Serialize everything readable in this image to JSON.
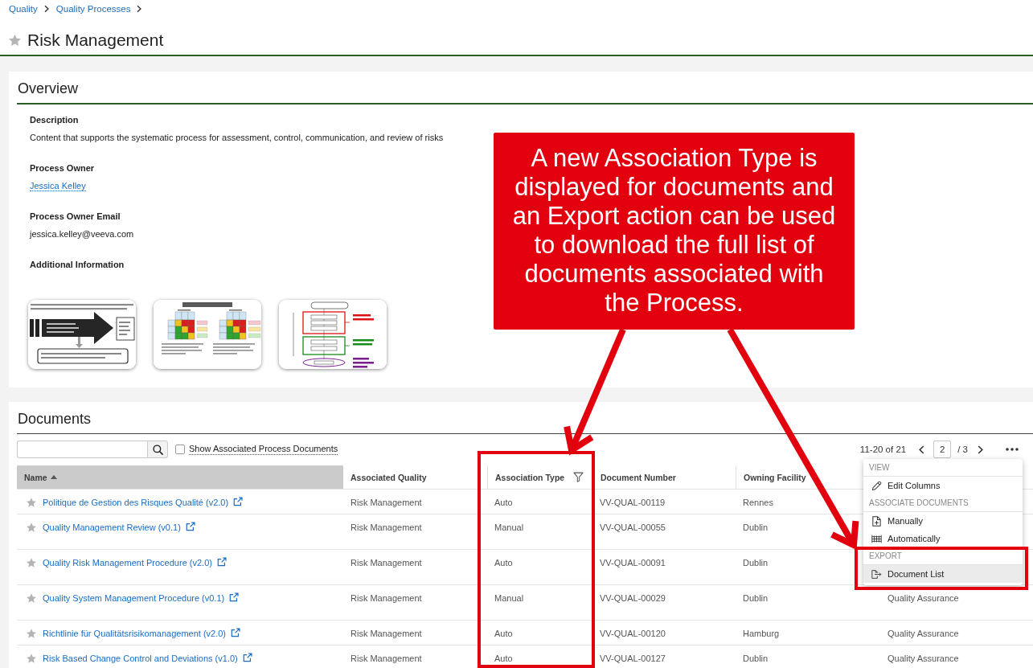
{
  "breadcrumb": [
    {
      "label": "Quality"
    },
    {
      "label": "Quality Processes"
    }
  ],
  "page": {
    "title": "Risk Management",
    "favorite": false
  },
  "overview": {
    "title": "Overview",
    "fields": [
      {
        "kind": "text",
        "label": "Description",
        "value": "Content that supports the systematic process for assessment, control, communication, and review of risks"
      },
      {
        "kind": "link",
        "label": "Process Owner",
        "value": "Jessica Kelley"
      },
      {
        "kind": "text",
        "label": "Process Owner Email",
        "value": "jessica.kelley@veeva.com"
      },
      {
        "kind": "images",
        "label": "Additional Information",
        "images": [
          {
            "kind": "arrow-diagram"
          },
          {
            "kind": "risk-matrix"
          },
          {
            "kind": "flowchart"
          }
        ]
      }
    ]
  },
  "documents": {
    "title": "Documents",
    "show_associated": {
      "label": "Show Associated Process Documents",
      "checked": false
    },
    "pagination": {
      "range": "11-20 of 21",
      "page": "2",
      "total": "/ 3"
    },
    "menu": {
      "sections": [
        {
          "heading": "VIEW",
          "items": [
            {
              "kind": "edit",
              "label": "Edit Columns",
              "selected": false
            }
          ]
        },
        {
          "heading": "ASSOCIATE DOCUMENTS",
          "items": [
            {
              "kind": "manual",
              "label": "Manually",
              "selected": false
            },
            {
              "kind": "automatic",
              "label": "Automatically",
              "selected": false
            }
          ]
        },
        {
          "heading": "EXPORT",
          "items": [
            {
              "kind": "export",
              "label": "Document List",
              "selected": true
            }
          ]
        }
      ]
    },
    "table": {
      "columns": [
        {
          "label": "Name",
          "sorted": true,
          "filter": false
        },
        {
          "label": "Associated Quality",
          "sorted": false,
          "filter": false
        },
        {
          "label": "Association Type",
          "sorted": false,
          "filter": true
        },
        {
          "label": "Document Number",
          "sorted": false,
          "filter": false
        },
        {
          "label": "Owning Facility",
          "sorted": false,
          "filter": false
        }
      ],
      "rows": [
        {
          "name": "Politique de Gestion des Risques Qualité (v2.0)",
          "favorite": false,
          "associated_quality": "Risk Management",
          "association_type": "Auto",
          "document_number": "VV-QUAL-00119",
          "owning_facility": "Rennes"
        },
        {
          "name": "Quality Management Review (v0.1)",
          "favorite": false,
          "associated_quality": "Risk Management",
          "association_type": "Manual",
          "document_number": "VV-QUAL-00055",
          "owning_facility": "Dublin"
        },
        {
          "name": "Quality Risk Management Procedure (v2.0)",
          "favorite": false,
          "associated_quality": "Risk Management",
          "association_type": "Auto",
          "document_number": "VV-QUAL-00091",
          "owning_facility": "Dublin"
        },
        {
          "name": "Quality System Management Procedure (v0.1)",
          "favorite": false,
          "associated_quality": "Risk Management",
          "association_type": "Manual",
          "document_number": "VV-QUAL-00029",
          "owning_facility": "Dublin",
          "column_6": "Quality Assurance"
        },
        {
          "name": "Richtlinie für Qualitätsrisikomanagement (v2.0)",
          "favorite": false,
          "associated_quality": "Risk Management",
          "association_type": "Auto",
          "document_number": "VV-QUAL-00120",
          "owning_facility": "Hamburg",
          "column_6": "Quality Assurance"
        },
        {
          "name": "Risk Based Change Control and Deviations (v1.0)",
          "favorite": false,
          "associated_quality": "Risk Management",
          "association_type": "Auto",
          "document_number": "VV-QUAL-00127",
          "owning_facility": "Dublin",
          "column_6": "Quality Assurance"
        }
      ]
    }
  },
  "annotation": {
    "callout": "A new Association Type is displayed for documents and an Export action can be used to download the full list of documents associated with the Process."
  }
}
